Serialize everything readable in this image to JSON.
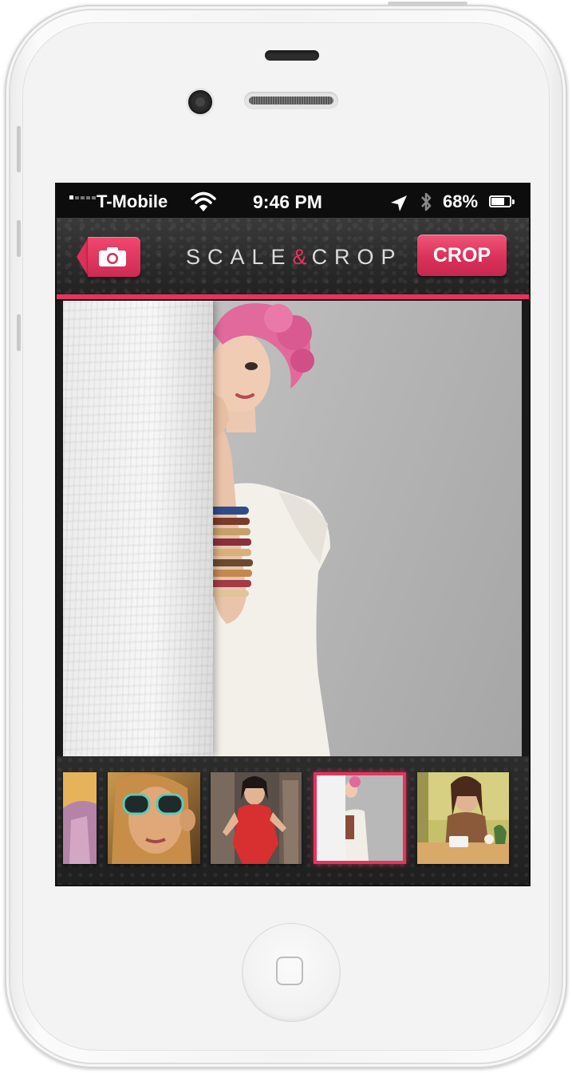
{
  "status_bar": {
    "carrier": "T-Mobile",
    "time": "9:46 PM",
    "battery_percent": "68%",
    "icons": [
      "signal-icon",
      "wifi-icon",
      "location-arrow-icon",
      "bluetooth-icon",
      "battery-icon"
    ]
  },
  "nav": {
    "logo_left": "SCALE",
    "logo_amp": "&",
    "logo_right": "CROP",
    "crop_button": "CROP",
    "camera_button_icon": "camera-icon"
  },
  "colors": {
    "accent": "#e8335f",
    "nav_background": "#2a2a2a",
    "status_bar": "#0d0d0d"
  },
  "main_photo": {
    "icon": "photo-woman-behind-wall"
  },
  "thumbnails": [
    {
      "icon": "photo-pink-clothes",
      "selected": false
    },
    {
      "icon": "photo-woman-sunglasses",
      "selected": false
    },
    {
      "icon": "photo-woman-red-dress",
      "selected": false
    },
    {
      "icon": "photo-woman-behind-wall",
      "selected": true
    },
    {
      "icon": "photo-woman-cafe",
      "selected": false
    }
  ]
}
